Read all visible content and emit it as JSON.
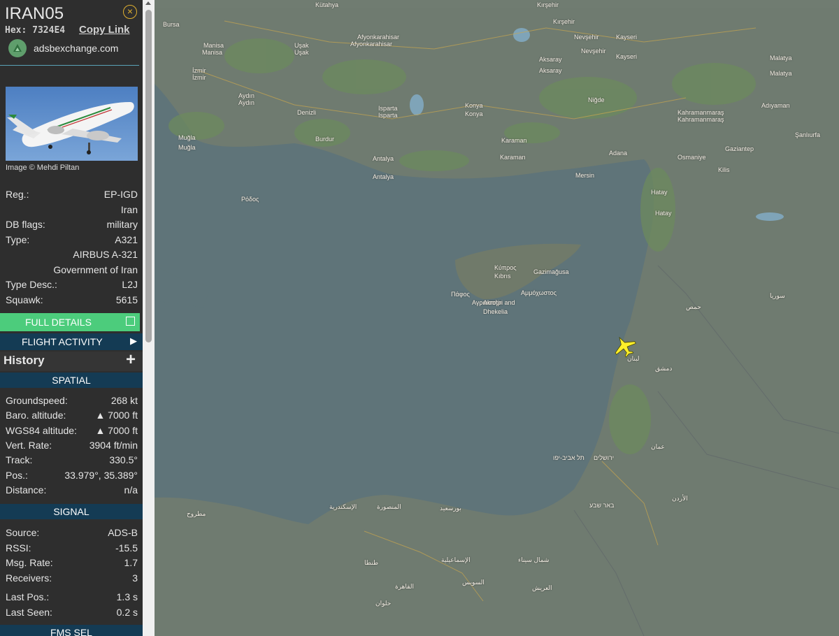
{
  "header": {
    "callsign": "IRAN05",
    "hex_label": "Hex:",
    "hex_value": "7324E4",
    "copy_link": "Copy Link",
    "site": "adsbexchange.com",
    "close_icon": "×"
  },
  "photo": {
    "credit": "Image © Mehdi Piltan"
  },
  "aircraft_rows": [
    {
      "key": "Reg.:",
      "value": "EP-IGD"
    },
    {
      "key": "",
      "value": "Iran"
    },
    {
      "key": "DB flags:",
      "value": "military"
    },
    {
      "key": "Type:",
      "value": "A321"
    },
    {
      "key": "",
      "value": "AIRBUS A-321"
    },
    {
      "key": "",
      "value": "Government of Iran"
    },
    {
      "key": "Type Desc.:",
      "value": "L2J"
    },
    {
      "key": "Squawk:",
      "value": "5615"
    }
  ],
  "buttons": {
    "full_details": "FULL DETAILS",
    "flight_activity": "FLIGHT ACTIVITY",
    "flight_activity_arrow": "▶",
    "history": "History",
    "history_plus": "+"
  },
  "sections": {
    "spatial": "SPATIAL",
    "signal": "SIGNAL",
    "fms": "FMS SEL"
  },
  "spatial_rows": [
    {
      "key": "Groundspeed:",
      "value": "268 kt"
    },
    {
      "key": "Baro. altitude:",
      "value": "▲ 7000 ft"
    },
    {
      "key": "WGS84 altitude:",
      "value": "▲ 7000 ft"
    },
    {
      "key": "Vert. Rate:",
      "value": "3904 ft/min"
    },
    {
      "key": "Track:",
      "value": "330.5°"
    },
    {
      "key": "Pos.:",
      "value": "33.979°, 35.389°"
    },
    {
      "key": "Distance:",
      "value": "n/a"
    }
  ],
  "signal_rows": [
    {
      "key": "Source:",
      "value": "ADS-B"
    },
    {
      "key": "RSSI:",
      "value": "-15.5"
    },
    {
      "key": "Msg. Rate:",
      "value": "1.7"
    },
    {
      "key": "Receivers:",
      "value": "3"
    },
    {
      "key": "Last Pos.:",
      "value": "1.3 s"
    },
    {
      "key": "Last Seen:",
      "value": "0.2 s"
    }
  ],
  "map": {
    "labels": [
      {
        "text": "Kütahya"
      },
      {
        "text": "Kırşehir"
      },
      {
        "text": "Kırşehir"
      },
      {
        "text": "Bursa"
      },
      {
        "text": "Afyonkarahisar"
      },
      {
        "text": "Afyonkarahisar"
      },
      {
        "text": "Nevşehir"
      },
      {
        "text": "Kayseri"
      },
      {
        "text": "Manisa"
      },
      {
        "text": "Uşak"
      },
      {
        "text": "Nevşehir"
      },
      {
        "text": "Kayseri"
      },
      {
        "text": "Manisa"
      },
      {
        "text": "Uşak"
      },
      {
        "text": "Aksaray"
      },
      {
        "text": "Malatya"
      },
      {
        "text": "İzmir"
      },
      {
        "text": "Aksaray"
      },
      {
        "text": "Malatya"
      },
      {
        "text": "İzmir"
      },
      {
        "text": "Aydın"
      },
      {
        "text": "Isparta"
      },
      {
        "text": "Konya"
      },
      {
        "text": "Kahramanmaraş"
      },
      {
        "text": "Aydın"
      },
      {
        "text": "Denizli"
      },
      {
        "text": "Isparta"
      },
      {
        "text": "Konya"
      },
      {
        "text": "Niğde"
      },
      {
        "text": "Kahramanmaraş"
      },
      {
        "text": "Adıyaman"
      },
      {
        "text": "Muğla"
      },
      {
        "text": "Burdur"
      },
      {
        "text": "Karaman"
      },
      {
        "text": "Adana"
      },
      {
        "text": "Osmaniye"
      },
      {
        "text": "Şanlıurfa"
      },
      {
        "text": "Muğla"
      },
      {
        "text": "Karaman"
      },
      {
        "text": "Gaziantep"
      },
      {
        "text": "Antalya"
      },
      {
        "text": "Mersin"
      },
      {
        "text": "Kilis"
      },
      {
        "text": "Antalya"
      },
      {
        "text": "Hatay"
      },
      {
        "text": "Ρόδος"
      },
      {
        "text": "Hatay"
      },
      {
        "text": "Κύπρος"
      },
      {
        "text": "Kıbrıs"
      },
      {
        "text": "Gazimağusa"
      },
      {
        "text": "Πάφος"
      },
      {
        "text": "Αμμόχωστος"
      },
      {
        "text": "Αγρωστήρι"
      },
      {
        "text": "Akrotiri and"
      },
      {
        "text": "Dhekelia"
      },
      {
        "text": "سوريا"
      },
      {
        "text": "حمص"
      },
      {
        "text": "دمشق"
      },
      {
        "text": "لبنان"
      },
      {
        "text": "عمان"
      },
      {
        "text": "ירושלים"
      },
      {
        "text": "תל אביב-יפו"
      },
      {
        "text": "באר שבע"
      },
      {
        "text": "الأردن"
      },
      {
        "text": "القاهرة"
      },
      {
        "text": "الإسكندرية"
      },
      {
        "text": "بورسعيد"
      },
      {
        "text": "الإسماعيلية"
      },
      {
        "text": "السويس"
      },
      {
        "text": "العريش"
      },
      {
        "text": "طنطا"
      },
      {
        "text": "المنصورة"
      },
      {
        "text": "حلوان"
      },
      {
        "text": "شمال سيناء"
      },
      {
        "text": "مطروح"
      }
    ]
  }
}
